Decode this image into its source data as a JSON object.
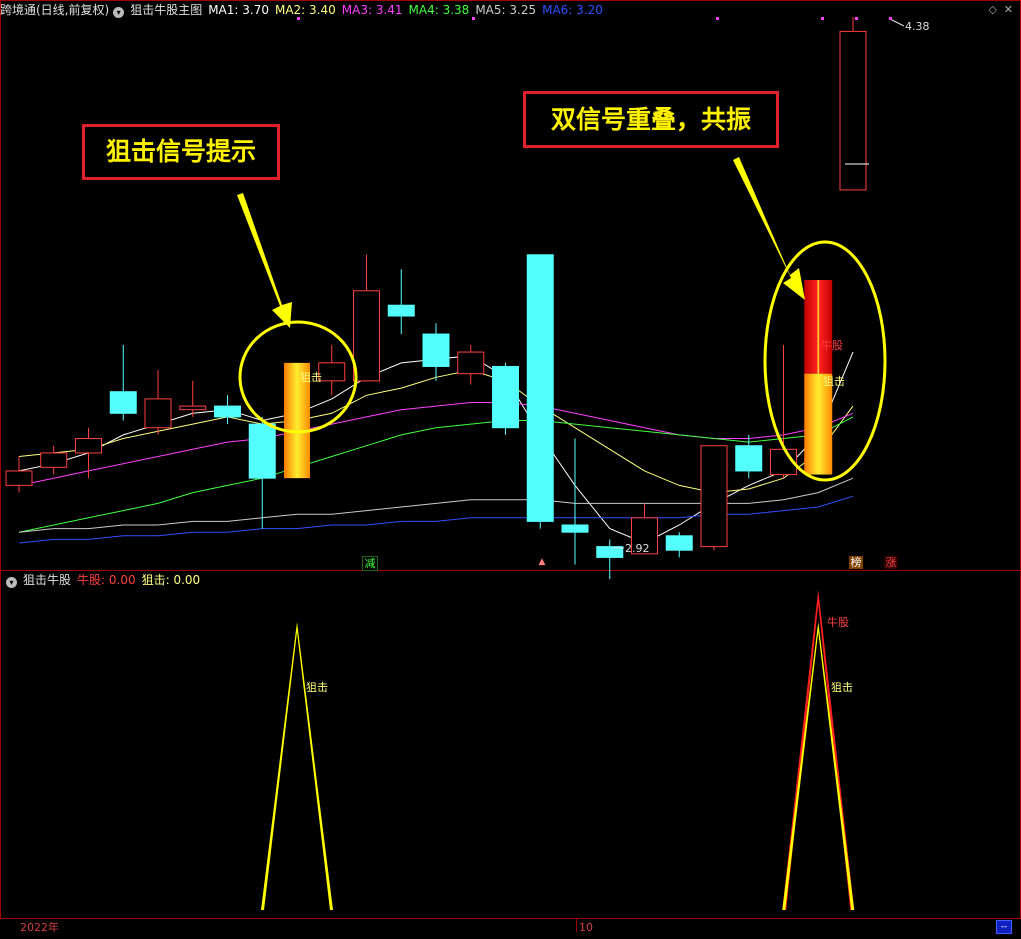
{
  "main_header": {
    "stock": "跨境通(日线,前复权)",
    "indicator": "狙击牛股主图",
    "ma": [
      {
        "label": "MA1: 3.70",
        "color": "#ffffff"
      },
      {
        "label": "MA2: 3.40",
        "color": "#ffff80"
      },
      {
        "label": "MA3: 3.41",
        "color": "#ff40ff"
      },
      {
        "label": "MA4: 3.38",
        "color": "#40ff40"
      },
      {
        "label": "MA5: 3.25",
        "color": "#cccccc"
      },
      {
        "label": "MA6: 3.20",
        "color": "#3050ff"
      }
    ]
  },
  "sub_header": {
    "indicator": "狙击牛股",
    "niugu": "牛股: 0.00",
    "juji": "狙击: 0.00"
  },
  "callouts": {
    "left": "狙击信号提示",
    "right": "双信号重叠，共振"
  },
  "chart_labels": {
    "high": "4.38",
    "low": "2.92",
    "juji": "狙击",
    "niugu": "牛股"
  },
  "markers": {
    "jian": "减",
    "bang": "榜",
    "zhang": "涨"
  },
  "x_axis": {
    "year": "2022年",
    "month": "10"
  },
  "colors": {
    "up": "#ff4040",
    "down": "#54ffff",
    "signal_yellow": "#ffff00",
    "signal_red": "#ff2020"
  },
  "chart_data": {
    "type": "candlestick",
    "candles": [
      {
        "o": 3.08,
        "c": 3.12,
        "h": 3.16,
        "l": 3.06
      },
      {
        "o": 3.13,
        "c": 3.17,
        "h": 3.19,
        "l": 3.11
      },
      {
        "o": 3.17,
        "c": 3.21,
        "h": 3.24,
        "l": 3.1
      },
      {
        "o": 3.34,
        "c": 3.28,
        "h": 3.47,
        "l": 3.26
      },
      {
        "o": 3.24,
        "c": 3.32,
        "h": 3.4,
        "l": 3.22
      },
      {
        "o": 3.29,
        "c": 3.3,
        "h": 3.37,
        "l": 3.27
      },
      {
        "o": 3.3,
        "c": 3.27,
        "h": 3.33,
        "l": 3.25
      },
      {
        "o": 3.25,
        "c": 3.1,
        "h": 3.27,
        "l": 2.96
      },
      {
        "o": 3.1,
        "c": 3.42,
        "h": 3.44,
        "l": 3.1
      },
      {
        "o": 3.37,
        "c": 3.42,
        "h": 3.47,
        "l": 3.33
      },
      {
        "o": 3.37,
        "c": 3.62,
        "h": 3.72,
        "l": 3.37
      },
      {
        "o": 3.58,
        "c": 3.55,
        "h": 3.68,
        "l": 3.5
      },
      {
        "o": 3.5,
        "c": 3.41,
        "h": 3.53,
        "l": 3.37
      },
      {
        "o": 3.39,
        "c": 3.45,
        "h": 3.47,
        "l": 3.36
      },
      {
        "o": 3.41,
        "c": 3.24,
        "h": 3.42,
        "l": 3.22
      },
      {
        "o": 3.72,
        "c": 2.98,
        "h": 3.72,
        "l": 2.96
      },
      {
        "o": 2.97,
        "c": 2.95,
        "h": 3.21,
        "l": 2.86
      },
      {
        "o": 2.91,
        "c": 2.88,
        "h": 2.93,
        "l": 2.82
      },
      {
        "o": 2.89,
        "c": 2.99,
        "h": 3.03,
        "l": 2.89
      },
      {
        "o": 2.94,
        "c": 2.9,
        "h": 2.95,
        "l": 2.88
      },
      {
        "o": 2.91,
        "c": 3.19,
        "h": 3.19,
        "l": 2.9
      },
      {
        "o": 3.19,
        "c": 3.12,
        "h": 3.22,
        "l": 3.1
      },
      {
        "o": 3.11,
        "c": 3.18,
        "h": 3.47,
        "l": 3.1
      },
      {
        "o": 3.11,
        "c": 3.65,
        "h": 3.65,
        "l": 3.11
      },
      {
        "o": 3.9,
        "c": 4.34,
        "h": 4.38,
        "l": 3.9
      }
    ],
    "ma_lines": [
      {
        "name": "MA1",
        "values": [
          3.12,
          3.14,
          3.17,
          3.22,
          3.25,
          3.28,
          3.29,
          3.26,
          3.28,
          3.32,
          3.38,
          3.42,
          3.43,
          3.44,
          3.38,
          3.22,
          3.08,
          2.96,
          2.92,
          2.97,
          3.03,
          3.08,
          3.12,
          3.22,
          3.45
        ]
      },
      {
        "name": "MA2",
        "values": [
          3.16,
          3.17,
          3.18,
          3.21,
          3.23,
          3.25,
          3.27,
          3.25,
          3.26,
          3.28,
          3.33,
          3.35,
          3.38,
          3.4,
          3.37,
          3.3,
          3.24,
          3.18,
          3.12,
          3.08,
          3.06,
          3.07,
          3.1,
          3.17,
          3.3
        ]
      },
      {
        "name": "MA3",
        "values": [
          3.08,
          3.1,
          3.12,
          3.14,
          3.16,
          3.18,
          3.2,
          3.21,
          3.23,
          3.25,
          3.27,
          3.29,
          3.3,
          3.31,
          3.31,
          3.3,
          3.28,
          3.26,
          3.24,
          3.22,
          3.21,
          3.21,
          3.22,
          3.24,
          3.28
        ]
      },
      {
        "name": "MA4",
        "values": [
          2.95,
          2.97,
          2.99,
          3.01,
          3.03,
          3.06,
          3.08,
          3.1,
          3.13,
          3.16,
          3.19,
          3.22,
          3.24,
          3.25,
          3.26,
          3.26,
          3.25,
          3.24,
          3.23,
          3.22,
          3.21,
          3.2,
          3.21,
          3.22,
          3.27
        ]
      },
      {
        "name": "MA5",
        "values": [
          2.95,
          2.96,
          2.96,
          2.97,
          2.97,
          2.98,
          2.98,
          2.99,
          3.0,
          3.0,
          3.01,
          3.02,
          3.03,
          3.04,
          3.04,
          3.04,
          3.03,
          3.03,
          3.03,
          3.03,
          3.03,
          3.03,
          3.04,
          3.06,
          3.1
        ]
      },
      {
        "name": "MA6",
        "values": [
          2.92,
          2.93,
          2.93,
          2.94,
          2.94,
          2.95,
          2.95,
          2.96,
          2.96,
          2.97,
          2.97,
          2.98,
          2.98,
          2.99,
          2.99,
          2.99,
          2.99,
          2.99,
          2.99,
          2.99,
          3.0,
          3.0,
          3.01,
          3.02,
          3.05
        ]
      }
    ],
    "signals": [
      {
        "bar": 8,
        "juji": 1,
        "niugu": 0
      },
      {
        "bar": 23,
        "juji": 1,
        "niugu": 1
      }
    ]
  }
}
